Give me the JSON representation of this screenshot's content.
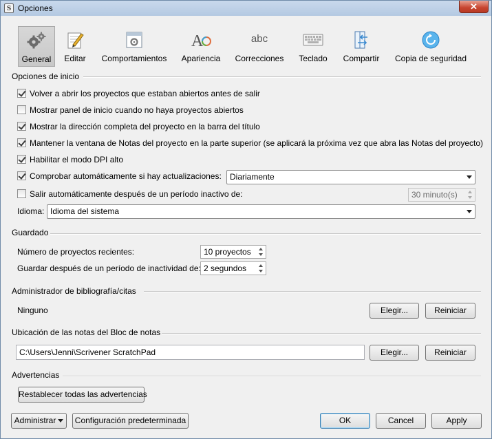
{
  "window": {
    "title": "Opciones",
    "close": "✕"
  },
  "toolbar": [
    {
      "label": "General",
      "icon": "gears-icon",
      "selected": true
    },
    {
      "label": "Editar",
      "icon": "edit-pencil-icon"
    },
    {
      "label": "Comportamientos",
      "icon": "window-gear-icon"
    },
    {
      "label": "Apariencia",
      "icon": "font-appearance-icon"
    },
    {
      "label": "Correcciones",
      "icon": "abc-spelling-icon",
      "glyph": "abc"
    },
    {
      "label": "Teclado",
      "icon": "keyboard-icon"
    },
    {
      "label": "Compartir",
      "icon": "share-sync-icon"
    },
    {
      "label": "Copia de seguridad",
      "icon": "backup-icon"
    }
  ],
  "startup": {
    "title": "Opciones de inicio",
    "options": [
      {
        "label": "Volver a abrir los proyectos que estaban abiertos antes de salir",
        "checked": true
      },
      {
        "label": "Mostrar panel de inicio cuando no haya proyectos abiertos",
        "checked": false
      },
      {
        "label": "Mostrar la dirección completa del proyecto en la barra del título",
        "checked": true
      },
      {
        "label": "Mantener la ventana de Notas del proyecto en la parte superior (se aplicará la próxima vez que abra las Notas del proyecto)",
        "checked": true
      },
      {
        "label": "Habilitar el modo DPI alto",
        "checked": true
      },
      {
        "label": "Comprobar automáticamente si hay actualizaciones:",
        "checked": true
      },
      {
        "label": "Salir automáticamente después de un período inactivo de:",
        "checked": false
      }
    ],
    "update_frequency": "Diariamente",
    "idle_timeout": "30 minuto(s)",
    "language_label": "Idioma:",
    "language_value": "Idioma del sistema"
  },
  "saving": {
    "title": "Guardado",
    "recent_label": "Número de proyectos recientes:",
    "recent_value": "10 proyectos",
    "autosave_label": "Guardar después de un período de inactividad de:",
    "autosave_value": "2 segundos"
  },
  "bibliography": {
    "title": "Administrador de bibliografía/citas",
    "value": "Ninguno",
    "choose": "Elegir...",
    "reset": "Reiniciar"
  },
  "scratchpad": {
    "title": "Ubicación de las notas del Bloc de notas",
    "path": "C:\\Users\\Jenni\\Scrivener ScratchPad",
    "choose": "Elegir...",
    "reset": "Reiniciar"
  },
  "warnings": {
    "title": "Advertencias",
    "reset_all": "Restablecer todas las advertencias"
  },
  "footer": {
    "manage": "Administrar",
    "defaults": "Configuración predeterminada",
    "ok": "OK",
    "cancel": "Cancel",
    "apply": "Apply"
  }
}
